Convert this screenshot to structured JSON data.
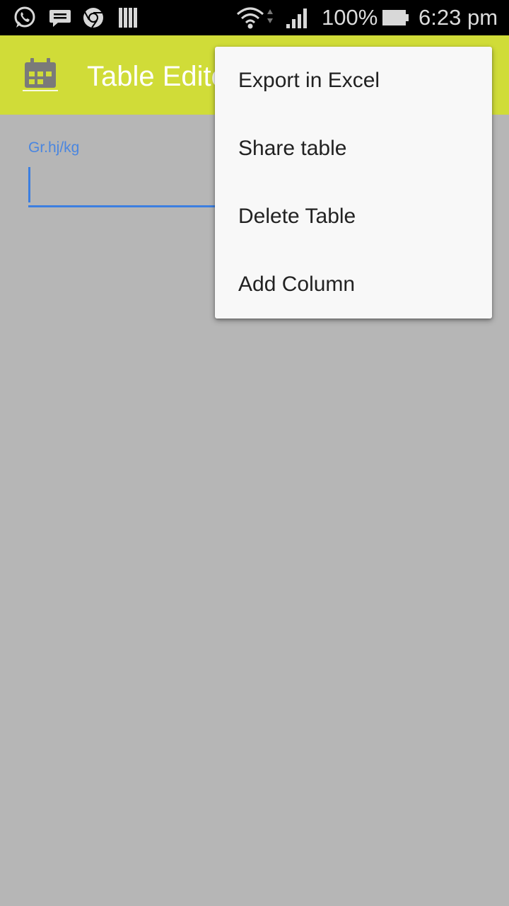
{
  "status_bar": {
    "battery_percent": "100%",
    "time": "6:23 pm",
    "icons": [
      "whatsapp-icon",
      "message-icon",
      "chrome-icon",
      "library-icon",
      "wifi-icon",
      "signal-icon",
      "battery-icon"
    ]
  },
  "app_bar": {
    "icon": "calendar-icon",
    "title": "Table Editor"
  },
  "form": {
    "field_label": "Gr.hj/kg",
    "field_value": ""
  },
  "popup_menu": {
    "items": [
      {
        "label": "Export in Excel"
      },
      {
        "label": "Share table"
      },
      {
        "label": "Delete Table"
      },
      {
        "label": "Add Column"
      }
    ]
  },
  "colors": {
    "app_bar": "#d0dc38",
    "accent": "#3c7fe0",
    "scrim_background": "#b6b6b6",
    "menu_background": "#f8f8f8"
  }
}
